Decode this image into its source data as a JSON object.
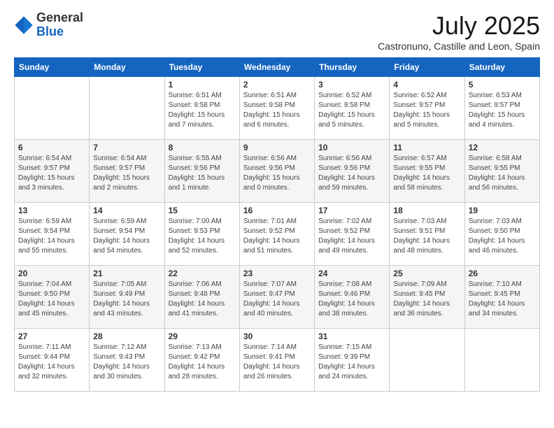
{
  "header": {
    "logo_general": "General",
    "logo_blue": "Blue",
    "month": "July 2025",
    "location": "Castronuno, Castille and Leon, Spain"
  },
  "days_of_week": [
    "Sunday",
    "Monday",
    "Tuesday",
    "Wednesday",
    "Thursday",
    "Friday",
    "Saturday"
  ],
  "weeks": [
    [
      {
        "day": "",
        "sunrise": "",
        "sunset": "",
        "daylight": ""
      },
      {
        "day": "",
        "sunrise": "",
        "sunset": "",
        "daylight": ""
      },
      {
        "day": "1",
        "sunrise": "Sunrise: 6:51 AM",
        "sunset": "Sunset: 9:58 PM",
        "daylight": "Daylight: 15 hours and 7 minutes."
      },
      {
        "day": "2",
        "sunrise": "Sunrise: 6:51 AM",
        "sunset": "Sunset: 9:58 PM",
        "daylight": "Daylight: 15 hours and 6 minutes."
      },
      {
        "day": "3",
        "sunrise": "Sunrise: 6:52 AM",
        "sunset": "Sunset: 9:58 PM",
        "daylight": "Daylight: 15 hours and 5 minutes."
      },
      {
        "day": "4",
        "sunrise": "Sunrise: 6:52 AM",
        "sunset": "Sunset: 9:57 PM",
        "daylight": "Daylight: 15 hours and 5 minutes."
      },
      {
        "day": "5",
        "sunrise": "Sunrise: 6:53 AM",
        "sunset": "Sunset: 9:57 PM",
        "daylight": "Daylight: 15 hours and 4 minutes."
      }
    ],
    [
      {
        "day": "6",
        "sunrise": "Sunrise: 6:54 AM",
        "sunset": "Sunset: 9:57 PM",
        "daylight": "Daylight: 15 hours and 3 minutes."
      },
      {
        "day": "7",
        "sunrise": "Sunrise: 6:54 AM",
        "sunset": "Sunset: 9:57 PM",
        "daylight": "Daylight: 15 hours and 2 minutes."
      },
      {
        "day": "8",
        "sunrise": "Sunrise: 6:55 AM",
        "sunset": "Sunset: 9:56 PM",
        "daylight": "Daylight: 15 hours and 1 minute."
      },
      {
        "day": "9",
        "sunrise": "Sunrise: 6:56 AM",
        "sunset": "Sunset: 9:56 PM",
        "daylight": "Daylight: 15 hours and 0 minutes."
      },
      {
        "day": "10",
        "sunrise": "Sunrise: 6:56 AM",
        "sunset": "Sunset: 9:56 PM",
        "daylight": "Daylight: 14 hours and 59 minutes."
      },
      {
        "day": "11",
        "sunrise": "Sunrise: 6:57 AM",
        "sunset": "Sunset: 9:55 PM",
        "daylight": "Daylight: 14 hours and 58 minutes."
      },
      {
        "day": "12",
        "sunrise": "Sunrise: 6:58 AM",
        "sunset": "Sunset: 9:55 PM",
        "daylight": "Daylight: 14 hours and 56 minutes."
      }
    ],
    [
      {
        "day": "13",
        "sunrise": "Sunrise: 6:59 AM",
        "sunset": "Sunset: 9:54 PM",
        "daylight": "Daylight: 14 hours and 55 minutes."
      },
      {
        "day": "14",
        "sunrise": "Sunrise: 6:59 AM",
        "sunset": "Sunset: 9:54 PM",
        "daylight": "Daylight: 14 hours and 54 minutes."
      },
      {
        "day": "15",
        "sunrise": "Sunrise: 7:00 AM",
        "sunset": "Sunset: 9:53 PM",
        "daylight": "Daylight: 14 hours and 52 minutes."
      },
      {
        "day": "16",
        "sunrise": "Sunrise: 7:01 AM",
        "sunset": "Sunset: 9:52 PM",
        "daylight": "Daylight: 14 hours and 51 minutes."
      },
      {
        "day": "17",
        "sunrise": "Sunrise: 7:02 AM",
        "sunset": "Sunset: 9:52 PM",
        "daylight": "Daylight: 14 hours and 49 minutes."
      },
      {
        "day": "18",
        "sunrise": "Sunrise: 7:03 AM",
        "sunset": "Sunset: 9:51 PM",
        "daylight": "Daylight: 14 hours and 48 minutes."
      },
      {
        "day": "19",
        "sunrise": "Sunrise: 7:03 AM",
        "sunset": "Sunset: 9:50 PM",
        "daylight": "Daylight: 14 hours and 46 minutes."
      }
    ],
    [
      {
        "day": "20",
        "sunrise": "Sunrise: 7:04 AM",
        "sunset": "Sunset: 9:50 PM",
        "daylight": "Daylight: 14 hours and 45 minutes."
      },
      {
        "day": "21",
        "sunrise": "Sunrise: 7:05 AM",
        "sunset": "Sunset: 9:49 PM",
        "daylight": "Daylight: 14 hours and 43 minutes."
      },
      {
        "day": "22",
        "sunrise": "Sunrise: 7:06 AM",
        "sunset": "Sunset: 9:48 PM",
        "daylight": "Daylight: 14 hours and 41 minutes."
      },
      {
        "day": "23",
        "sunrise": "Sunrise: 7:07 AM",
        "sunset": "Sunset: 9:47 PM",
        "daylight": "Daylight: 14 hours and 40 minutes."
      },
      {
        "day": "24",
        "sunrise": "Sunrise: 7:08 AM",
        "sunset": "Sunset: 9:46 PM",
        "daylight": "Daylight: 14 hours and 38 minutes."
      },
      {
        "day": "25",
        "sunrise": "Sunrise: 7:09 AM",
        "sunset": "Sunset: 9:45 PM",
        "daylight": "Daylight: 14 hours and 36 minutes."
      },
      {
        "day": "26",
        "sunrise": "Sunrise: 7:10 AM",
        "sunset": "Sunset: 9:45 PM",
        "daylight": "Daylight: 14 hours and 34 minutes."
      }
    ],
    [
      {
        "day": "27",
        "sunrise": "Sunrise: 7:11 AM",
        "sunset": "Sunset: 9:44 PM",
        "daylight": "Daylight: 14 hours and 32 minutes."
      },
      {
        "day": "28",
        "sunrise": "Sunrise: 7:12 AM",
        "sunset": "Sunset: 9:43 PM",
        "daylight": "Daylight: 14 hours and 30 minutes."
      },
      {
        "day": "29",
        "sunrise": "Sunrise: 7:13 AM",
        "sunset": "Sunset: 9:42 PM",
        "daylight": "Daylight: 14 hours and 28 minutes."
      },
      {
        "day": "30",
        "sunrise": "Sunrise: 7:14 AM",
        "sunset": "Sunset: 9:41 PM",
        "daylight": "Daylight: 14 hours and 26 minutes."
      },
      {
        "day": "31",
        "sunrise": "Sunrise: 7:15 AM",
        "sunset": "Sunset: 9:39 PM",
        "daylight": "Daylight: 14 hours and 24 minutes."
      },
      {
        "day": "",
        "sunrise": "",
        "sunset": "",
        "daylight": ""
      },
      {
        "day": "",
        "sunrise": "",
        "sunset": "",
        "daylight": ""
      }
    ]
  ]
}
